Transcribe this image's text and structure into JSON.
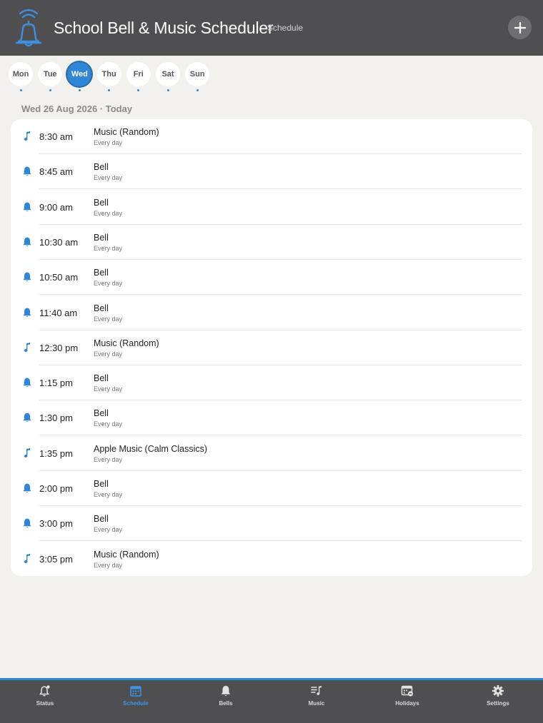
{
  "header": {
    "title": "School Bell & Music Scheduler",
    "subtitle": "Schedule",
    "add_label": "+"
  },
  "days": [
    {
      "label": "Mon",
      "active": false
    },
    {
      "label": "Tue",
      "active": false
    },
    {
      "label": "Wed",
      "active": true
    },
    {
      "label": "Thu",
      "active": false
    },
    {
      "label": "Fri",
      "active": false
    },
    {
      "label": "Sat",
      "active": false
    },
    {
      "label": "Sun",
      "active": false
    }
  ],
  "date_heading": "Wed 26 Aug 2026 · Today",
  "schedule": [
    {
      "icon": "music-note-icon",
      "time": "8:30 am",
      "title": "Music (Random)",
      "repeat": "Every day"
    },
    {
      "icon": "bell-icon",
      "time": "8:45 am",
      "title": "Bell",
      "repeat": "Every day"
    },
    {
      "icon": "bell-icon",
      "time": "9:00 am",
      "title": "Bell",
      "repeat": "Every day"
    },
    {
      "icon": "bell-icon",
      "time": "10:30 am",
      "title": "Bell",
      "repeat": "Every day"
    },
    {
      "icon": "bell-icon",
      "time": "10:50 am",
      "title": "Bell",
      "repeat": "Every day"
    },
    {
      "icon": "bell-icon",
      "time": "11:40 am",
      "title": "Bell",
      "repeat": "Every day"
    },
    {
      "icon": "music-note-icon",
      "time": "12:30 pm",
      "title": "Music (Random)",
      "repeat": "Every day"
    },
    {
      "icon": "bell-icon",
      "time": "1:15 pm",
      "title": "Bell",
      "repeat": "Every day"
    },
    {
      "icon": "bell-icon",
      "time": "1:30 pm",
      "title": "Bell",
      "repeat": "Every day"
    },
    {
      "icon": "music-note-icon",
      "time": "1:35 pm",
      "title": "Apple Music (Calm Classics)",
      "repeat": "Every day"
    },
    {
      "icon": "bell-icon",
      "time": "2:00 pm",
      "title": "Bell",
      "repeat": "Every day"
    },
    {
      "icon": "bell-icon",
      "time": "3:00 pm",
      "title": "Bell",
      "repeat": "Every day"
    },
    {
      "icon": "music-note-icon",
      "time": "3:05 pm",
      "title": "Music (Random)",
      "repeat": "Every day"
    }
  ],
  "tabs": [
    {
      "label": "Status",
      "icon": "bell-alert-icon",
      "active": false
    },
    {
      "label": "Schedule",
      "icon": "calendar-icon",
      "active": true
    },
    {
      "label": "Bells",
      "icon": "bell-icon",
      "active": false
    },
    {
      "label": "Music",
      "icon": "music-list-icon",
      "active": false
    },
    {
      "label": "Holidays",
      "icon": "calendar-remove-icon",
      "active": false
    },
    {
      "label": "Settings",
      "icon": "gear-icon",
      "active": false
    }
  ],
  "colors": {
    "accent": "#2f86d6",
    "header_bg": "#4f4f51",
    "page_bg": "#f2f1ee"
  }
}
